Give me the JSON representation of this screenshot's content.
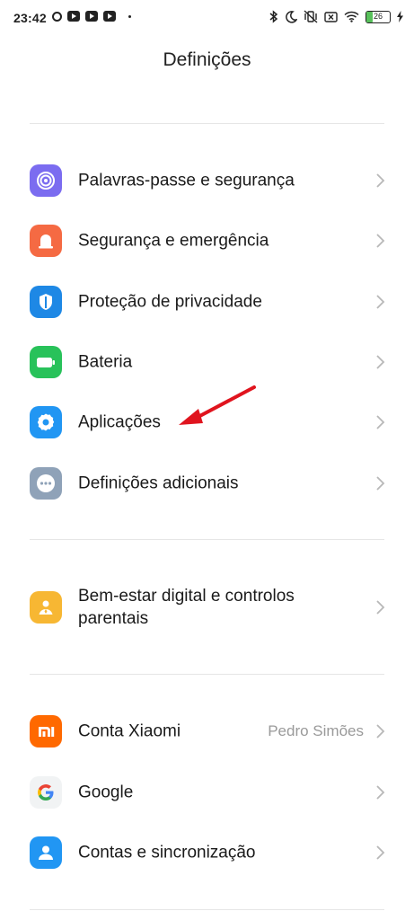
{
  "status_bar": {
    "time": "23:42",
    "battery": "26",
    "icons": [
      "whatsapp-icon",
      "youtube-icon",
      "youtube-icon",
      "youtube-icon",
      "bluetooth-icon",
      "moon-icon",
      "vibrate-off-icon",
      "sim-x-icon",
      "wifi-icon",
      "battery-icon",
      "charging-icon"
    ]
  },
  "header": {
    "title": "Definições"
  },
  "groups": [
    {
      "items": [
        {
          "label": "Palavras-passe e segurança",
          "icon": "fingerprint-icon",
          "color": "#7b6cf0"
        },
        {
          "label": "Segurança e emergência",
          "icon": "siren-icon",
          "color": "#f56a43"
        },
        {
          "label": "Proteção de privacidade",
          "icon": "privacy-shield-icon",
          "color": "#1e88e5"
        },
        {
          "label": "Bateria",
          "icon": "battery-icon",
          "color": "#28c25a"
        },
        {
          "label": "Aplicações",
          "icon": "gear-icon",
          "color": "#2196f3"
        },
        {
          "label": "Definições adicionais",
          "icon": "more-dots-icon",
          "color": "#8fa2b8"
        }
      ]
    },
    {
      "items": [
        {
          "label": "Bem-estar digital e controlos parentais",
          "icon": "wellbeing-icon",
          "color": "#f7b733"
        }
      ]
    },
    {
      "items": [
        {
          "label": "Conta Xiaomi",
          "value": "Pedro Simões",
          "icon": "xiaomi-icon",
          "color": "#ff6900"
        },
        {
          "label": "Google",
          "icon": "google-icon",
          "color": "#f1f3f4"
        },
        {
          "label": "Contas e sincronização",
          "icon": "account-icon",
          "color": "#2196f3"
        }
      ]
    }
  ],
  "annotation": {
    "arrow_color": "#e0141e"
  }
}
